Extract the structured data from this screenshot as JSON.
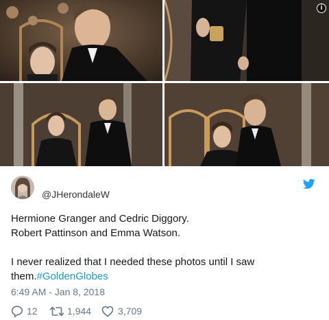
{
  "photos": {
    "info_badge": "i"
  },
  "tweet": {
    "handle": "@JHerondaleW",
    "lines": [
      "Hermione Granger and Cedric Diggory.",
      "Robert Pattinson and Emma Watson.",
      "I never realized that I needed these photos until I saw",
      "them."
    ],
    "hashtag": "#GoldenGlobes",
    "timestamp": "6:49 AM - Jan 8, 2018",
    "replies": "12",
    "retweets": "1,944",
    "likes": "3,709"
  },
  "colors": {
    "brand_blue": "#1da1f2",
    "hashtag": "#1b95e0",
    "muted": "#657786"
  },
  "icons": [
    "info-icon",
    "twitter-bird-icon",
    "reply-icon",
    "retweet-icon",
    "like-icon"
  ]
}
